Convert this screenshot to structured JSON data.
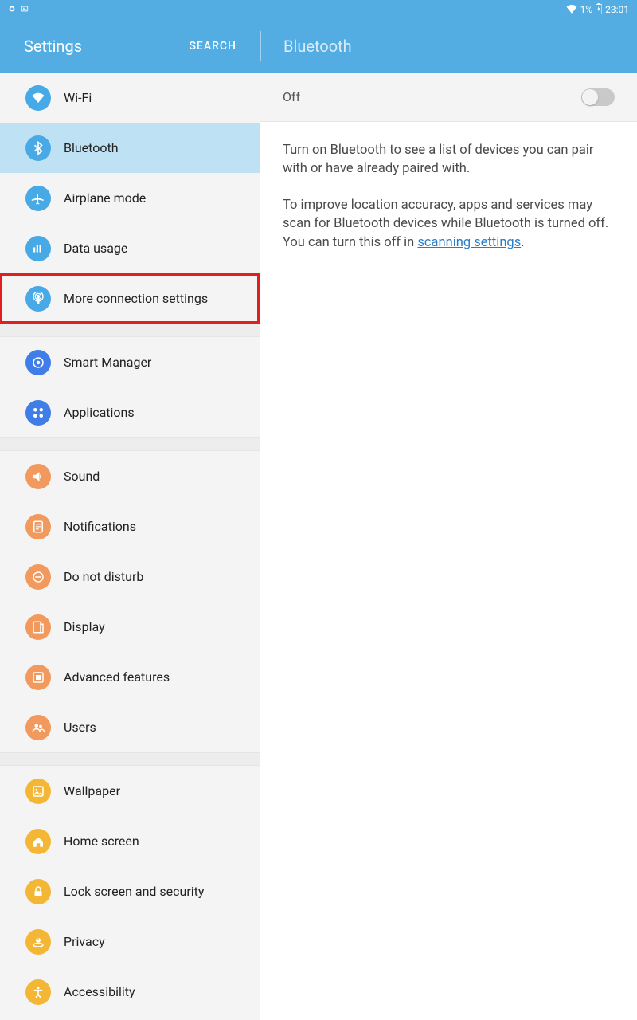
{
  "status": {
    "battery": "1%",
    "time": "23:01"
  },
  "header": {
    "title": "Settings",
    "search": "SEARCH",
    "detail_title": "Bluetooth"
  },
  "sidebar": {
    "groups": [
      [
        {
          "label": "Wi-Fi",
          "color": "blue",
          "icon": "wifi"
        },
        {
          "label": "Bluetooth",
          "color": "blue",
          "icon": "bluetooth",
          "selected": true
        },
        {
          "label": "Airplane mode",
          "color": "blue",
          "icon": "airplane"
        },
        {
          "label": "Data usage",
          "color": "blue",
          "icon": "data"
        },
        {
          "label": "More connection settings",
          "color": "blue",
          "icon": "antenna",
          "highlighted": true
        }
      ],
      [
        {
          "label": "Smart Manager",
          "color": "blue2",
          "icon": "smart"
        },
        {
          "label": "Applications",
          "color": "blue2",
          "icon": "apps"
        }
      ],
      [
        {
          "label": "Sound",
          "color": "orange",
          "icon": "sound"
        },
        {
          "label": "Notifications",
          "color": "orange",
          "icon": "notif"
        },
        {
          "label": "Do not disturb",
          "color": "orange",
          "icon": "dnd"
        },
        {
          "label": "Display",
          "color": "orange",
          "icon": "display"
        },
        {
          "label": "Advanced features",
          "color": "orange",
          "icon": "adv"
        },
        {
          "label": "Users",
          "color": "orange",
          "icon": "users"
        }
      ],
      [
        {
          "label": "Wallpaper",
          "color": "yellow",
          "icon": "wall"
        },
        {
          "label": "Home screen",
          "color": "yellow",
          "icon": "home"
        },
        {
          "label": "Lock screen and security",
          "color": "yellow",
          "icon": "lock"
        },
        {
          "label": "Privacy",
          "color": "yellow",
          "icon": "privacy"
        },
        {
          "label": "Accessibility",
          "color": "yellow",
          "icon": "access"
        }
      ]
    ]
  },
  "content": {
    "toggle_label": "Off",
    "desc1": "Turn on Bluetooth to see a list of devices you can pair with or have already paired with.",
    "desc2_a": "To improve location accuracy, apps and services may scan for Bluetooth devices while Bluetooth is turned off. You can turn this off in ",
    "desc2_link": "scanning settings",
    "desc2_b": "."
  }
}
